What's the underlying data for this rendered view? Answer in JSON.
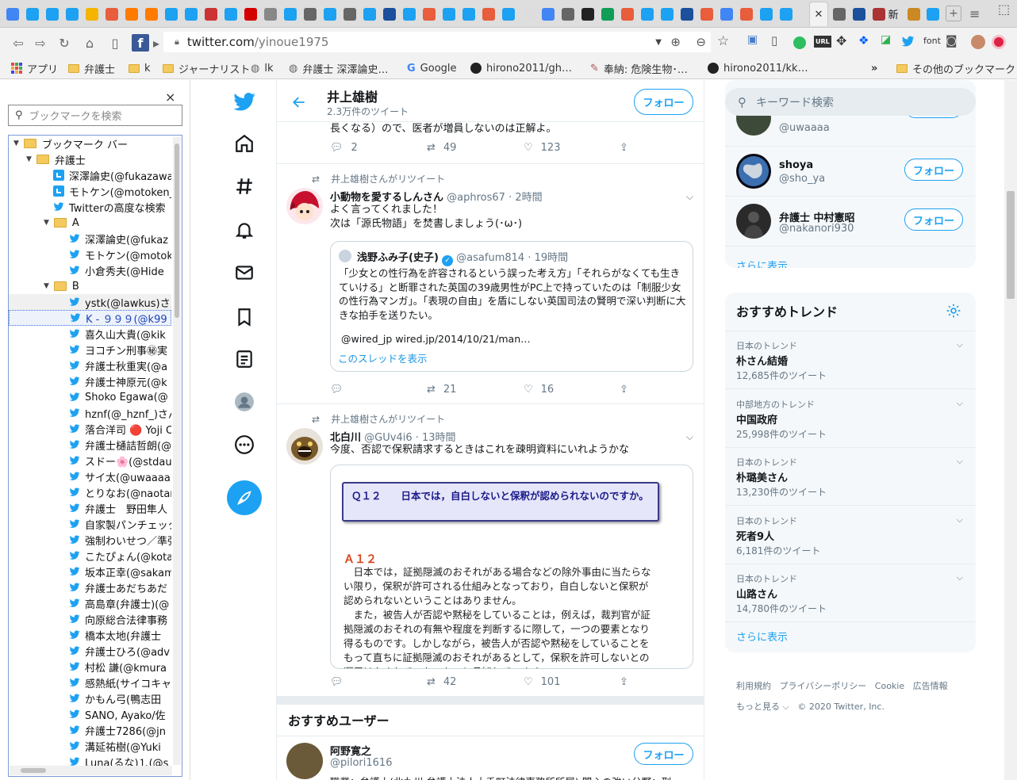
{
  "browser": {
    "url_domain": "twitter.com",
    "url_path": "/yinoue1975",
    "bookmarks": [
      {
        "label": "アプリ"
      },
      {
        "label": "弁護士"
      },
      {
        "label": "k"
      },
      {
        "label": "ジャーナリスト"
      },
      {
        "label": "lk"
      },
      {
        "label": "弁護士 深澤論史…"
      },
      {
        "label": "Google"
      },
      {
        "label": "hirono2011/gh…"
      },
      {
        "label": "奉納: 危険生物･…"
      },
      {
        "label": "hirono2011/kk…"
      },
      {
        "label": "その他のブックマーク"
      }
    ],
    "bookmark_overflow": "»",
    "ext_url_label": "URL",
    "ext_font_label": "font",
    "new_tab_glyph": "新"
  },
  "sidepanel": {
    "close": "×",
    "search_placeholder": "ブックマークを検索",
    "tree": [
      {
        "label": "ブックマーク バー",
        "type": "folder",
        "depth": 0
      },
      {
        "label": "弁護士",
        "type": "folder",
        "depth": 1
      },
      {
        "label": "深澤論史(@fukazawa",
        "type": "tw2",
        "depth": 3
      },
      {
        "label": "モトケン(@motoken_",
        "type": "tw2",
        "depth": 3
      },
      {
        "label": "Twitterの高度な検索",
        "type": "tw",
        "depth": 3
      },
      {
        "label": "A",
        "type": "folder",
        "depth": 2
      },
      {
        "label": "深澤論史(@fukaz",
        "type": "tw",
        "depth": 4
      },
      {
        "label": "モトケン(@motok",
        "type": "tw",
        "depth": 4
      },
      {
        "label": "小倉秀夫(@Hide",
        "type": "tw",
        "depth": 4
      },
      {
        "label": "B",
        "type": "folder",
        "depth": 2
      },
      {
        "label": "ystk(@lawkus)さん",
        "type": "tw",
        "depth": 4,
        "hover": true
      },
      {
        "label": "K - ９９９(@k99",
        "type": "tw",
        "depth": 4,
        "selected": true
      },
      {
        "label": "喜久山大貴(@kik",
        "type": "tw",
        "depth": 4
      },
      {
        "label": "ヨコチン刑事㊙実",
        "type": "tw",
        "depth": 4
      },
      {
        "label": "弁護士秋重実(@a",
        "type": "tw",
        "depth": 4
      },
      {
        "label": "弁護士神原元(@k",
        "type": "tw",
        "depth": 4
      },
      {
        "label": "Shoko Egawa(@",
        "type": "tw",
        "depth": 4
      },
      {
        "label": "hznf(@_hznf_)さん",
        "type": "tw",
        "depth": 4
      },
      {
        "label": "落合洋司 🔴 Yoji O",
        "type": "tw",
        "depth": 4
      },
      {
        "label": "弁護士樋詰哲朗(@",
        "type": "tw",
        "depth": 4
      },
      {
        "label": "スドー🌸(@stdau",
        "type": "tw",
        "depth": 4
      },
      {
        "label": "サイ太(@uwaaaa)",
        "type": "tw",
        "depth": 4
      },
      {
        "label": "とりなお(@naotar",
        "type": "tw",
        "depth": 4
      },
      {
        "label": "弁護士　野田隼人",
        "type": "tw",
        "depth": 4
      },
      {
        "label": "自家製パンチェッタ",
        "type": "tw",
        "depth": 4
      },
      {
        "label": "強制わいせつ／準強",
        "type": "tw",
        "depth": 4
      },
      {
        "label": "こたぴょん(@kota",
        "type": "tw",
        "depth": 4
      },
      {
        "label": "坂本正幸(@sakam",
        "type": "tw",
        "depth": 4
      },
      {
        "label": "弁護士あだちあだ",
        "type": "tw",
        "depth": 4
      },
      {
        "label": "高島章(弁護士)(@",
        "type": "tw",
        "depth": 4
      },
      {
        "label": "向原総合法律事務",
        "type": "tw",
        "depth": 4
      },
      {
        "label": "橋本太地(弁護士",
        "type": "tw",
        "depth": 4
      },
      {
        "label": "弁護士ひろ(@adv",
        "type": "tw",
        "depth": 4
      },
      {
        "label": "村松 謙(@kmura",
        "type": "tw",
        "depth": 4
      },
      {
        "label": "感熱紙(サイコキャ",
        "type": "tw",
        "depth": 4
      },
      {
        "label": "かもん弓(鴨志田",
        "type": "tw",
        "depth": 4
      },
      {
        "label": "SANO, Ayako/佐",
        "type": "tw",
        "depth": 4
      },
      {
        "label": "弁護士7286(@jn",
        "type": "tw",
        "depth": 4
      },
      {
        "label": "溝延祐樹(@Yuki",
        "type": "tw",
        "depth": 4
      },
      {
        "label": "Luna(るな)🄂(@s",
        "type": "tw",
        "depth": 4
      }
    ]
  },
  "profile": {
    "name": "井上雄樹",
    "tweet_count": "2.3万件のツイート",
    "follow_label": "フォロー"
  },
  "tweets": {
    "t0": {
      "body_tail": "長くなる）ので、医者が増員しないのは正解よ。",
      "replies": "2",
      "retweets": "49",
      "likes": "123"
    },
    "t1": {
      "rt_label": "井上雄樹さんがリツイート",
      "name": "小動物を愛するしんさん",
      "handle": "@aphros67",
      "time": "· 2時間",
      "line1": "よく言ってくれました！",
      "line2": "次は「源氏物語」を焚書しましょう(･ω･)",
      "quote": {
        "name": "浅野ふみ子(史子)",
        "handle": "@asafum814",
        "time": "· 19時間",
        "text": "「少女との性行為を許容されるという誤った考え方」「それらがなくても生きていける」と断罪された英国の39歳男性がPC上で持っていたのは「制服少女の性行為マンガ」。「表現の自由」を盾にしない英国司法の賢明で深い判断に大きな拍手を送りたい。",
        "link": "@wired_jp wired.jp/2014/10/21/man…",
        "thread": "このスレッドを表示"
      },
      "replies": "",
      "retweets": "21",
      "likes": "16"
    },
    "t2": {
      "rt_label": "井上雄樹さんがリツイート",
      "name": "北白川",
      "handle": "@GUv4i6",
      "time": "· 13時間",
      "text": "今度、否認で保釈請求するときはこれを疎明資料にいれようかな",
      "image": {
        "q_title": "Ｑ１２　　日本では，自白しないと保釈が認められないのですか。",
        "a_label": "Ａ１２",
        "a_text": "　日本では，証拠隠滅のおそれがある場合などの除外事由に当たらない限り，保釈が許可される仕組みとなっており，自白しないと保釈が認められないということはありません。\n　また，被告人が否認や黙秘をしていることは，例えば，裁判官が証拠隠滅のおそれの有無や程度を判断するに際して，一つの要素となり得るものです。しかしながら，被告人が否認や黙秘をしていることをもって直ちに証拠隠滅のおそれがあるとして，保釈を許可しないとの運用はなされていないものと承知しています。"
      },
      "replies": "",
      "retweets": "42",
      "likes": "101"
    }
  },
  "recommend": {
    "title": "おすすめユーザー",
    "user": {
      "name": "阿野寛之",
      "handle": "@pilori1616",
      "bio": "職業：弁護士(北九州 弁護士法人大手町法律事務所所属) 関心の強い分野：刑",
      "follow_label": "フォロー"
    }
  },
  "right": {
    "search_placeholder": "キーワード検索",
    "follow_label": "フォロー",
    "users": [
      {
        "name": "",
        "handle": "@uwaaaa"
      },
      {
        "name": "shoya",
        "handle": "@sho_ya"
      },
      {
        "name": "弁護士 中村憲昭",
        "handle": "@nakanori930"
      }
    ],
    "users_more": "さらに表示",
    "trends_title": "おすすめトレンド",
    "trends": [
      {
        "category": "日本のトレンド",
        "name": "朴さん結婚",
        "count": "12,685件のツイート"
      },
      {
        "category": "中部地方のトレンド",
        "name": "中国政府",
        "count": "25,998件のツイート"
      },
      {
        "category": "日本のトレンド",
        "name": "朴璐美さん",
        "count": "13,230件のツイート"
      },
      {
        "category": "日本のトレンド",
        "name": "死者9人",
        "count": "6,181件のツイート"
      },
      {
        "category": "日本のトレンド",
        "name": "山路さん",
        "count": "14,780件のツイート"
      }
    ],
    "trends_more": "さらに表示",
    "footer": {
      "terms": "利用規約",
      "privacy": "プライバシーポリシー",
      "cookie": "Cookie",
      "ads": "広告情報",
      "more": "もっと見る ⌵",
      "copyright": "© 2020 Twitter, Inc."
    }
  },
  "colors": {
    "twitter_blue": "#1da1f2",
    "text_secondary": "#657786",
    "border": "#e6ecf0"
  }
}
